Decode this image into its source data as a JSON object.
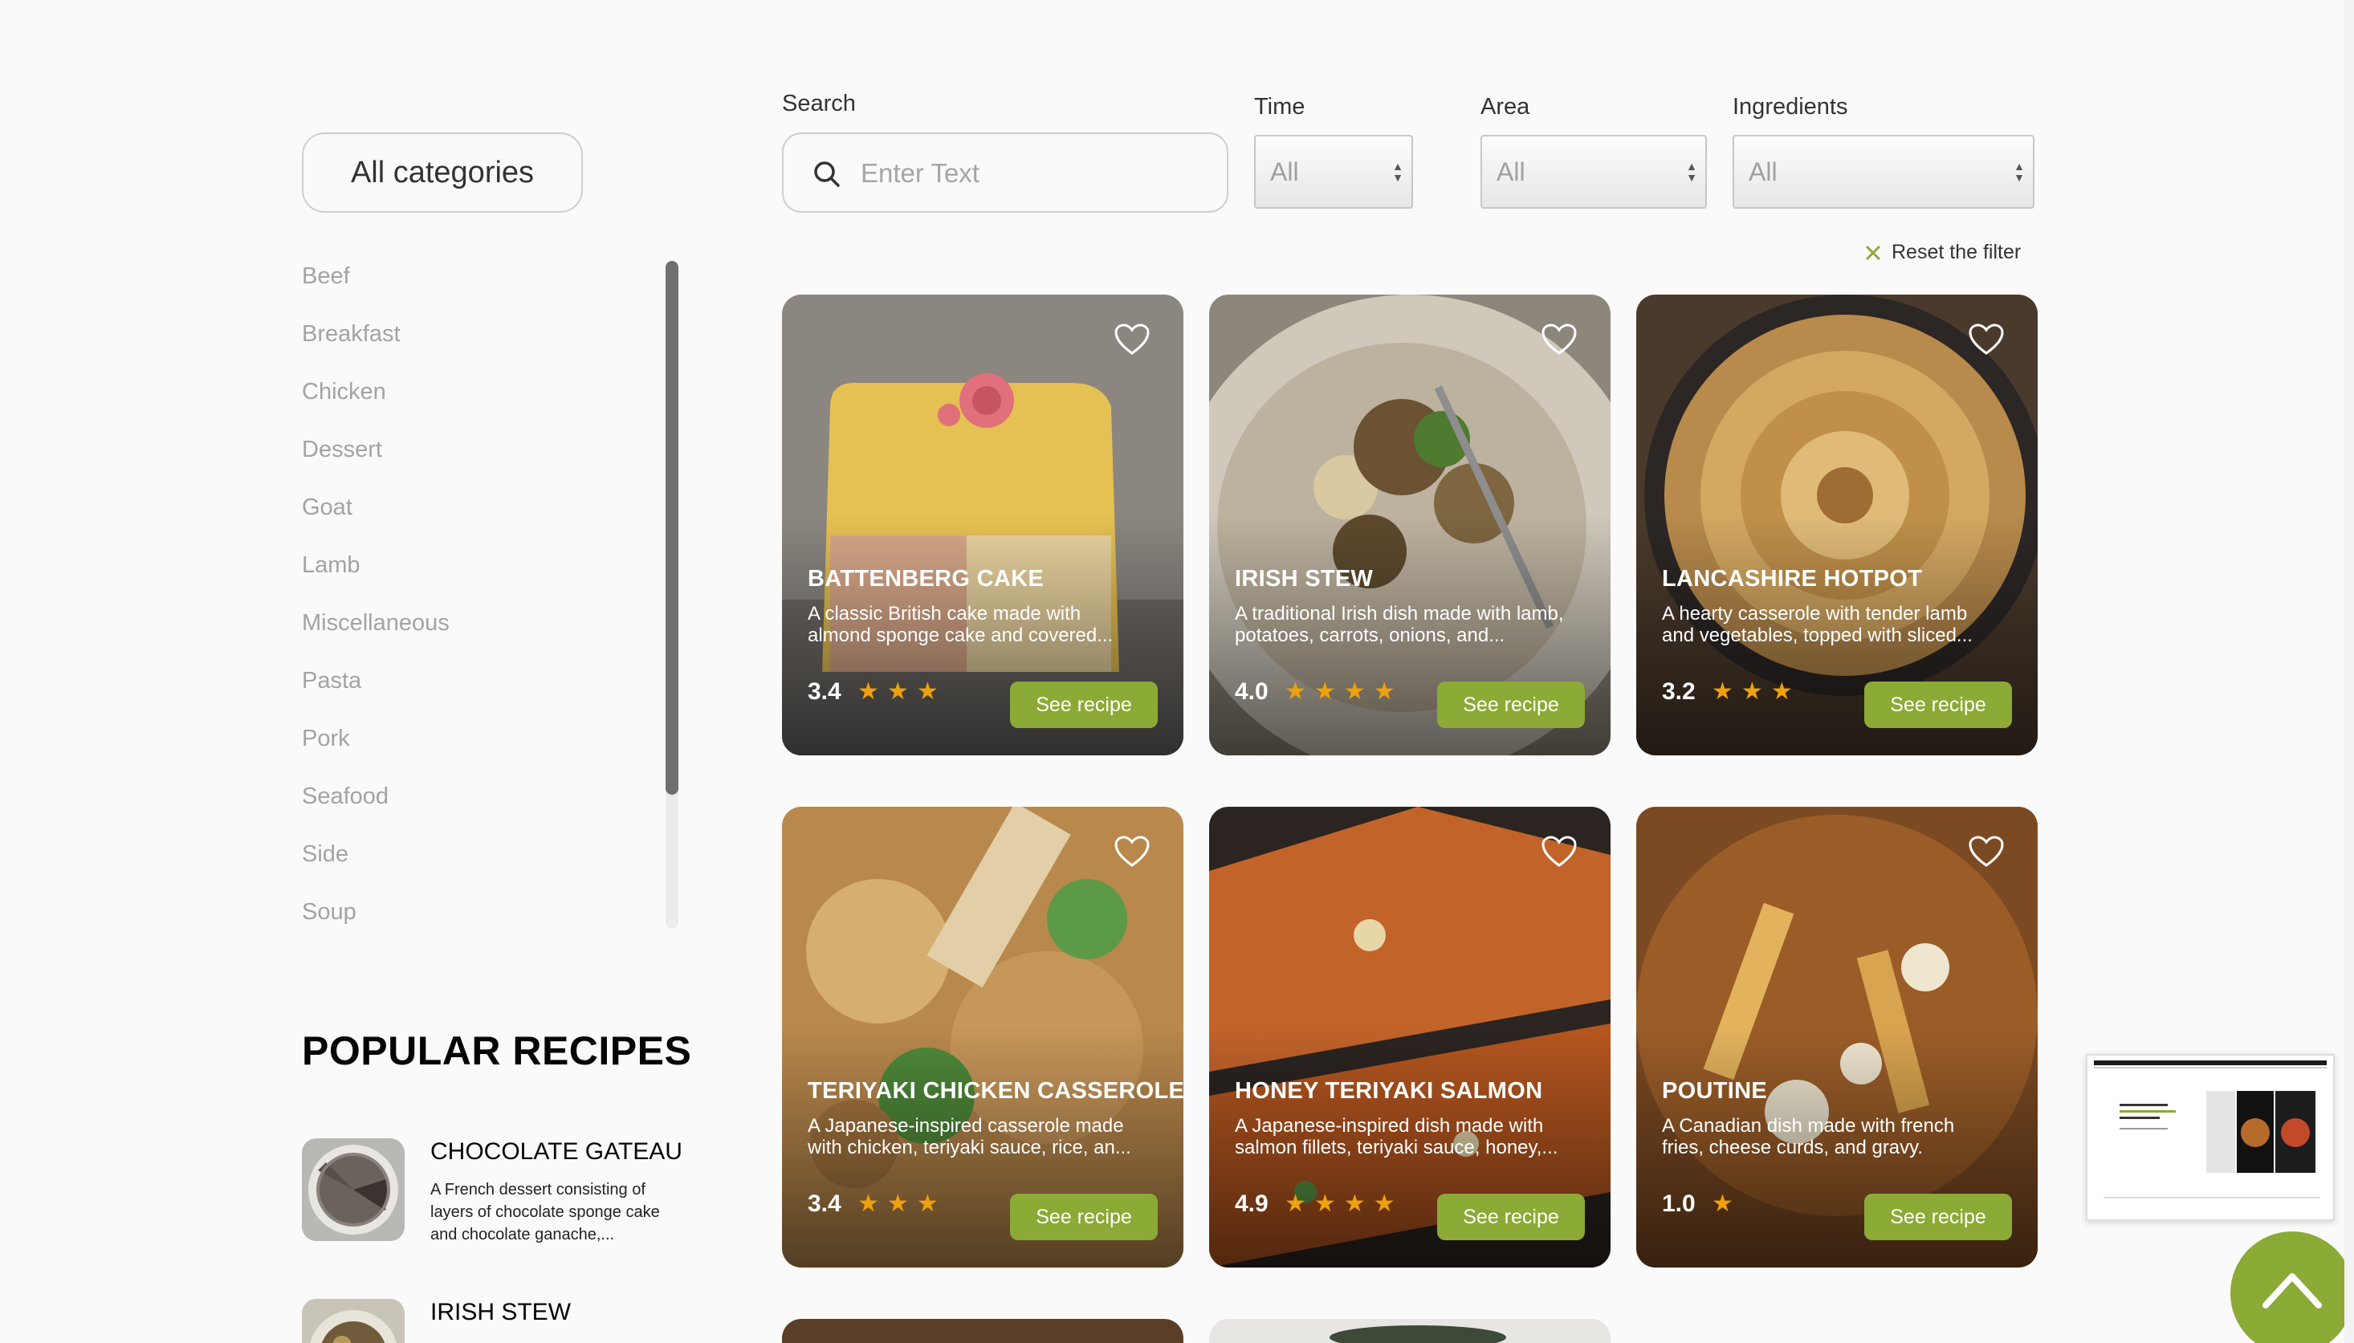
{
  "sidebar": {
    "all_categories_label": "All categories",
    "categories": [
      "Beef",
      "Breakfast",
      "Chicken",
      "Dessert",
      "Goat",
      "Lamb",
      "Miscellaneous",
      "Pasta",
      "Pork",
      "Seafood",
      "Side",
      "Soup"
    ]
  },
  "popular": {
    "title": "POPULAR RECIPES",
    "items": [
      {
        "name": "CHOCOLATE GATEAU",
        "desc": "A French dessert consisting of layers of chocolate sponge cake and chocolate ganache,..."
      },
      {
        "name": "IRISH STEW",
        "desc": ""
      }
    ]
  },
  "filters": {
    "search_label": "Search",
    "search_placeholder": "Enter Text",
    "time_label": "Time",
    "time_value": "All",
    "area_label": "Area",
    "area_value": "All",
    "ingredients_label": "Ingredients",
    "ingredients_value": "All",
    "reset_label": "Reset the filter"
  },
  "cards": [
    {
      "title": "BATTENBERG CAKE",
      "desc": "A classic British cake made with almond sponge cake and covered...",
      "rating": "3.4",
      "stars": 3,
      "button": "See recipe"
    },
    {
      "title": "IRISH STEW",
      "desc": "A traditional Irish dish made with lamb, potatoes, carrots, onions, and...",
      "rating": "4.0",
      "stars": 4,
      "button": "See recipe"
    },
    {
      "title": "LANCASHIRE HOTPOT",
      "desc": "A hearty casserole with tender lamb and vegetables, topped with sliced...",
      "rating": "3.2",
      "stars": 3,
      "button": "See recipe"
    },
    {
      "title": "TERIYAKI CHICKEN CASSEROLE",
      "desc": "A Japanese-inspired casserole made with chicken, teriyaki sauce, rice, an...",
      "rating": "3.4",
      "stars": 3,
      "button": "See recipe"
    },
    {
      "title": "HONEY TERIYAKI SALMON",
      "desc": "A Japanese-inspired dish made with salmon fillets, teriyaki sauce, honey,...",
      "rating": "4.9",
      "stars": 4,
      "button": "See recipe"
    },
    {
      "title": "POUTINE",
      "desc": "A Canadian dish made with french fries, cheese curds, and gravy.",
      "rating": "1.0",
      "stars": 1,
      "button": "See recipe"
    }
  ],
  "colors": {
    "accent": "#8baa36",
    "star": "#eea10a"
  },
  "icons": {
    "search": "search-icon",
    "heart": "heart-icon",
    "reset": "close-icon",
    "scroll_up": "chevron-up-icon"
  }
}
